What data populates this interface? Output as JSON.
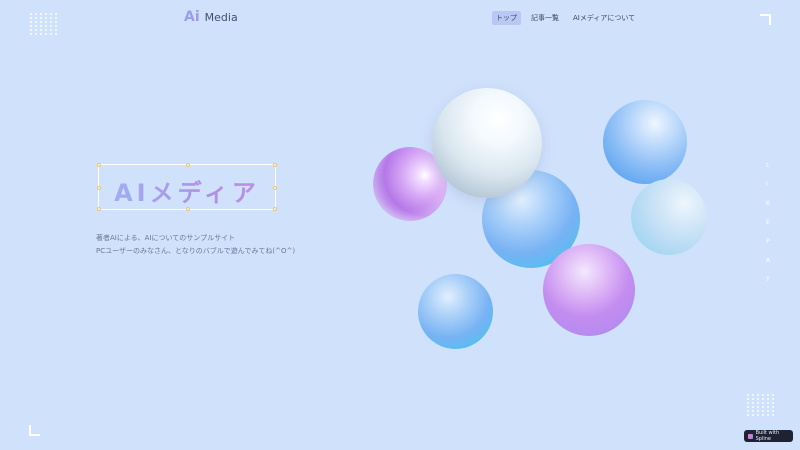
{
  "logo": {
    "mark": "Ai",
    "name": "Media"
  },
  "nav": [
    {
      "label": "トップ",
      "active": true
    },
    {
      "label": "記事一覧",
      "active": false
    },
    {
      "label": "AIメディアについて",
      "active": false
    }
  ],
  "hero": {
    "title": "AIメディア",
    "description_line1": "著者AIによる、AIについてのサンプルサイト",
    "description_line2": "PCユーザーのみなさん、となりのバブルで遊んでみてね(^O^)"
  },
  "side_text": [
    "L",
    "I",
    "K",
    "E",
    "P",
    "A",
    "Y"
  ],
  "badge": {
    "label": "Built with Spline"
  },
  "colors": {
    "background": "#cfe1fb",
    "accent_purple": "#b677e8",
    "accent_blue": "#4fc0ee"
  }
}
